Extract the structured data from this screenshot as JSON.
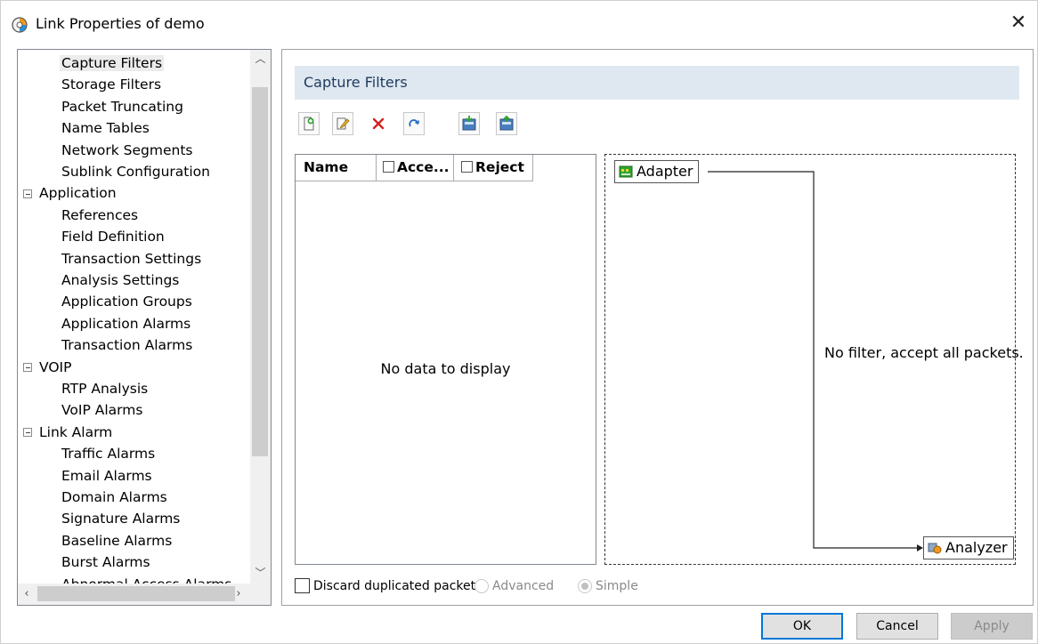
{
  "window": {
    "title": "Link Properties of demo",
    "close_glyph": "✕"
  },
  "tree": {
    "items": [
      {
        "label": "Capture Filters",
        "type": "child",
        "selected": true
      },
      {
        "label": "Storage Filters",
        "type": "child"
      },
      {
        "label": "Packet Truncating",
        "type": "child"
      },
      {
        "label": "Name Tables",
        "type": "child"
      },
      {
        "label": "Network Segments",
        "type": "child"
      },
      {
        "label": "Sublink Configuration",
        "type": "child"
      },
      {
        "label": "Application",
        "type": "group"
      },
      {
        "label": "References",
        "type": "child"
      },
      {
        "label": "Field Definition",
        "type": "child"
      },
      {
        "label": "Transaction Settings",
        "type": "child"
      },
      {
        "label": "Analysis Settings",
        "type": "child"
      },
      {
        "label": "Application Groups",
        "type": "child"
      },
      {
        "label": "Application Alarms",
        "type": "child"
      },
      {
        "label": "Transaction Alarms",
        "type": "child"
      },
      {
        "label": "VOIP",
        "type": "group"
      },
      {
        "label": "RTP Analysis",
        "type": "child"
      },
      {
        "label": "VoIP Alarms",
        "type": "child"
      },
      {
        "label": "Link Alarm",
        "type": "group"
      },
      {
        "label": "Traffic Alarms",
        "type": "child"
      },
      {
        "label": "Email Alarms",
        "type": "child"
      },
      {
        "label": "Domain Alarms",
        "type": "child"
      },
      {
        "label": "Signature Alarms",
        "type": "child"
      },
      {
        "label": "Baseline Alarms",
        "type": "child"
      },
      {
        "label": "Burst Alarms",
        "type": "child"
      },
      {
        "label": "Abnormal Access Alarms",
        "type": "child"
      }
    ]
  },
  "section": {
    "title": "Capture Filters"
  },
  "toolbar": [
    "add-filter-icon",
    "edit-filter-icon",
    "delete-icon",
    "refresh-icon",
    "import-icon",
    "export-icon"
  ],
  "filter_table": {
    "columns": {
      "name": "Name",
      "accept": "Acce...",
      "reject": "Reject"
    },
    "empty_message": "No data to display"
  },
  "flow": {
    "source": "Adapter",
    "target": "Analyzer",
    "note": "No filter, accept all packets."
  },
  "options": {
    "discard_duplicates": {
      "label": "Discard duplicated packets",
      "checked": false
    },
    "mode_advanced": {
      "label": "Advanced",
      "selected": false
    },
    "mode_simple": {
      "label": "Simple",
      "selected": true
    }
  },
  "buttons": {
    "ok": "OK",
    "cancel": "Cancel",
    "apply": "Apply"
  },
  "colors": {
    "header_bg": "#dfe8f0",
    "accent": "#0078d7",
    "delete_red": "#d42020"
  }
}
